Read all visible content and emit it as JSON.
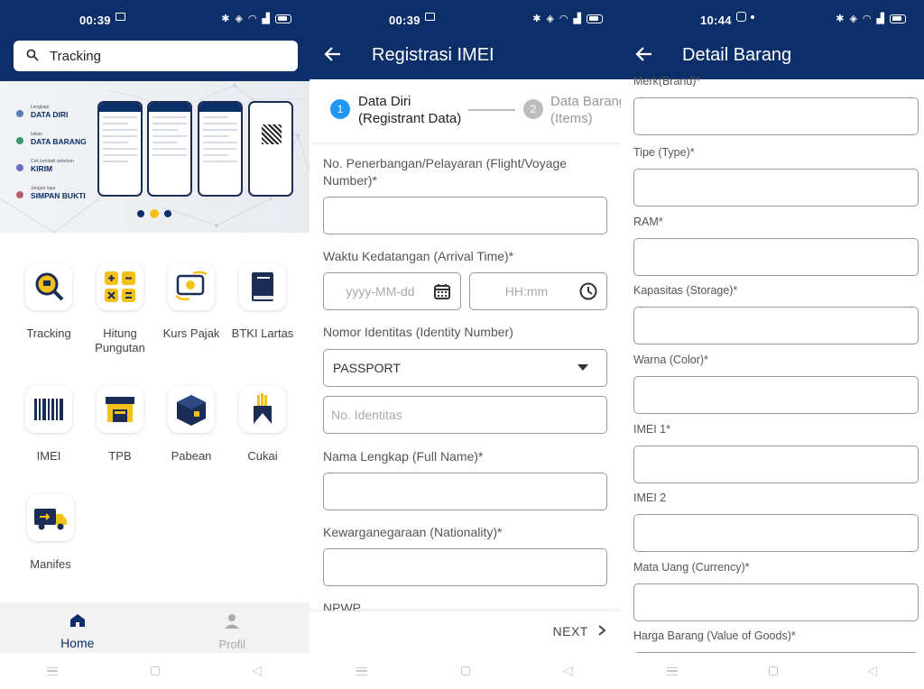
{
  "screen1": {
    "status": {
      "time": "00:39"
    },
    "search": {
      "value": "Tracking"
    },
    "banner": {
      "steps": [
        {
          "sub": "Lengkapi",
          "title": "DATA DIRI",
          "color": "#5b7fb5"
        },
        {
          "sub": "Isikan",
          "title": "DATA BARANG",
          "color": "#3a9a6b"
        },
        {
          "sub": "Cek kembali sebelum",
          "title": "KIRIM",
          "color": "#6b6fc0"
        },
        {
          "sub": "Jangan lupa",
          "title": "SIMPAN BUKTI",
          "color": "#c05b6b"
        }
      ]
    },
    "menu": [
      {
        "label": "Tracking",
        "icon": "tracking-magnifier-icon"
      },
      {
        "label": "Hitung\nPungutan",
        "icon": "calculator-icon"
      },
      {
        "label": "Kurs Pajak",
        "icon": "currency-exchange-icon"
      },
      {
        "label": "BTKI Lartas",
        "icon": "book-icon"
      },
      {
        "label": "IMEI",
        "icon": "barcode-icon"
      },
      {
        "label": "TPB",
        "icon": "warehouse-icon"
      },
      {
        "label": "Pabean",
        "icon": "box-icon"
      },
      {
        "label": "Cukai",
        "icon": "cigarette-pack-icon"
      },
      {
        "label": "Manifes",
        "icon": "delivery-truck-icon"
      }
    ],
    "bottom_nav": {
      "home": "Home",
      "profile": "Profil"
    }
  },
  "screen2": {
    "status": {
      "time": "00:39"
    },
    "title": "Registrasi IMEI",
    "steps": [
      {
        "num": "1",
        "line1": "Data Diri",
        "line2": "(Registrant Data)"
      },
      {
        "num": "2",
        "line1": "Data Barang",
        "line2": "(Items)"
      }
    ],
    "fields": {
      "flight_label": "No. Penerbangan/Pelayaran (Flight/Voyage Number)*",
      "arrival_label": "Waktu Kedatangan (Arrival Time)*",
      "date_placeholder": "yyyy-MM-dd",
      "time_placeholder": "HH:mm",
      "identity_label": "Nomor Identitas (Identity Number)",
      "identity_type": "PASSPORT",
      "identity_placeholder": "No. Identitas",
      "name_label": "Nama Lengkap (Full Name)*",
      "nationality_label": "Kewarganegaraan (Nationality)*",
      "npwp_label": "NPWP"
    },
    "next": "NEXT"
  },
  "screen3": {
    "status": {
      "time": "10:44"
    },
    "title": "Detail Barang",
    "fields": [
      {
        "label": "Merk(Brand)*"
      },
      {
        "label": "Tipe (Type)*"
      },
      {
        "label": "RAM*"
      },
      {
        "label": "Kapasitas (Storage)*"
      },
      {
        "label": "Warna (Color)*"
      },
      {
        "label": "IMEI 1*"
      },
      {
        "label": "IMEI 2"
      },
      {
        "label": "Mata Uang (Currency)*"
      },
      {
        "label": "Harga Barang (Value of Goods)*"
      }
    ]
  },
  "colors": {
    "primary": "#0c2f6a",
    "accent": "#2196f3",
    "yellow": "#f3c11b"
  }
}
